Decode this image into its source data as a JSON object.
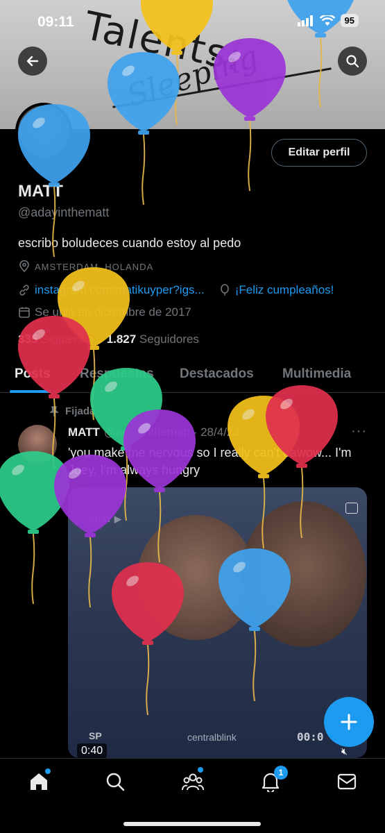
{
  "status_bar": {
    "time": "09:11",
    "battery": "95"
  },
  "banner": {
    "line1": "Talents:",
    "line2": "Sleeping"
  },
  "profile": {
    "edit_label": "Editar perfil",
    "name": "MATT",
    "handle": "@adayinthematt",
    "bio": "escribo boludeces cuando estoy al pedo",
    "location": "AMSTERDAM, HOLANDA",
    "link": "instagram.com/matikuyper?igs...",
    "birthday": "¡Feliz cumpleaños!",
    "joined": "Se unió en diciembre de 2017",
    "following_count": "335",
    "following_label": "Siguiendo",
    "followers_count": "1.827",
    "followers_label": "Seguidores"
  },
  "tabs": [
    "Posts",
    "Respuestas",
    "Destacados",
    "Multimedia"
  ],
  "post": {
    "pinned_label": "Fijada",
    "author": "MATT",
    "handle_date": "@adayinthematt · 28/4/23",
    "more": "···",
    "text": "'you make me nervous so I really can't eawow... I'm Joey, I'm always hungry",
    "video": {
      "play_label": "PLAY ▶",
      "watermark": "centralblink",
      "sp": "SP",
      "counter": "00:0",
      "duration": "0:40"
    }
  },
  "nav": {
    "notification_count": "1"
  },
  "colors": {
    "accent": "#1d9bf0",
    "background": "#000000",
    "muted": "#71767b"
  },
  "balloon_colors": [
    "#f4c21c",
    "#3fa2ee",
    "#9b35d6",
    "#e0304e",
    "#2ecc8a"
  ]
}
